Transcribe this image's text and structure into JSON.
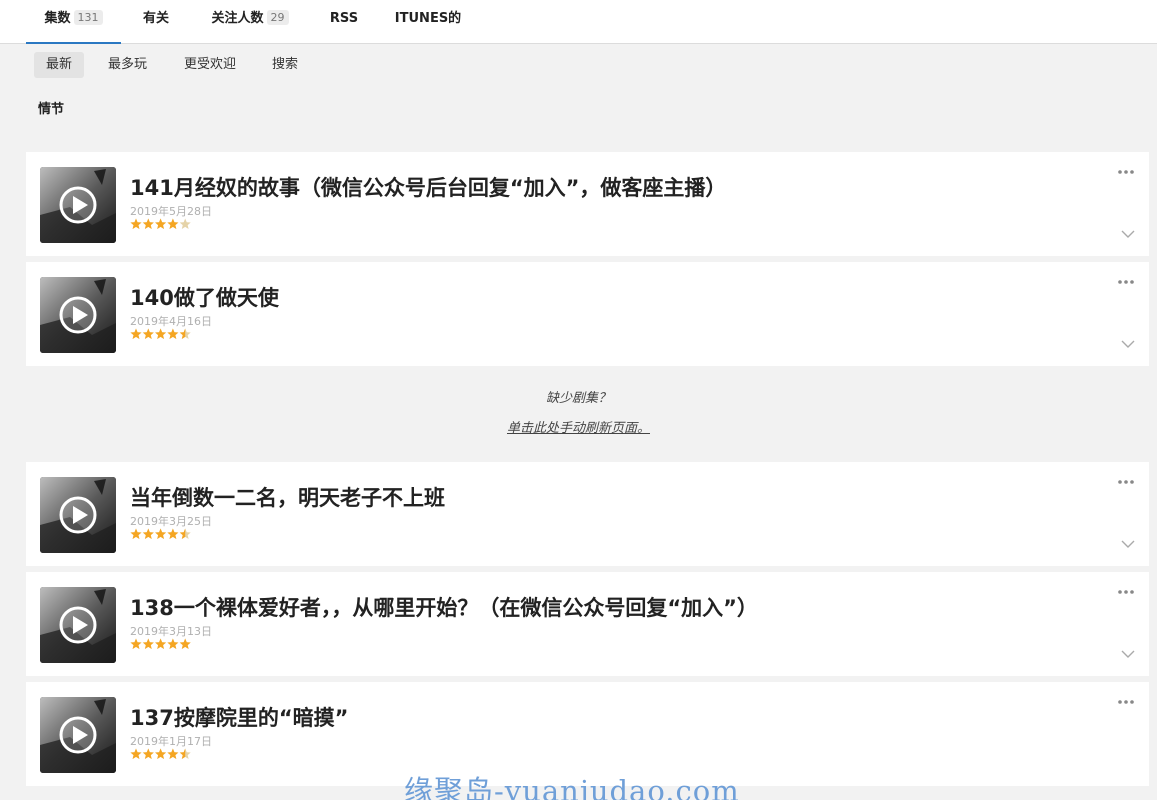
{
  "tabs": [
    {
      "label": "集数",
      "badge": "131"
    },
    {
      "label": "有关",
      "badge": ""
    },
    {
      "label": "关注人数",
      "badge": "29"
    },
    {
      "label": "RSS",
      "badge": ""
    },
    {
      "label": "ITUNES的",
      "badge": ""
    }
  ],
  "subtabs": [
    "最新",
    "最多玩",
    "更受欢迎",
    "搜索"
  ],
  "section_label": "情节",
  "episodes": [
    {
      "title": "141月经奴的故事（微信公众号后台回复“加入”，做客座主播）",
      "date": "2019年5月28日",
      "rating": 4
    },
    {
      "title": "140做了做天使",
      "date": "2019年4月16日",
      "rating": 4.5
    },
    {
      "title": "当年倒数一二名，明天老子不上班",
      "date": "2019年3月25日",
      "rating": 4.5
    },
    {
      "title": "138一个裸体爱好者，，从哪里开始？（在微信公众号回复“加入”）",
      "date": "2019年3月13日",
      "rating": 5
    },
    {
      "title": "137按摩院里的“暗摸”",
      "date": "2019年1月17日",
      "rating": 4.5
    }
  ],
  "missing": {
    "question": "缺少剧集？",
    "link": "单击此处手动刷新页面。"
  },
  "watermark": "缘聚岛-yuanjudao.com",
  "icons": {
    "thumb": "play-icon",
    "menu": "more-dots-icon",
    "expand": "chevron-down-icon",
    "rating": "star-icon"
  },
  "colors": {
    "accent": "#2b78c2",
    "star": "#f5a623",
    "star_empty": "#e5d3a8"
  }
}
